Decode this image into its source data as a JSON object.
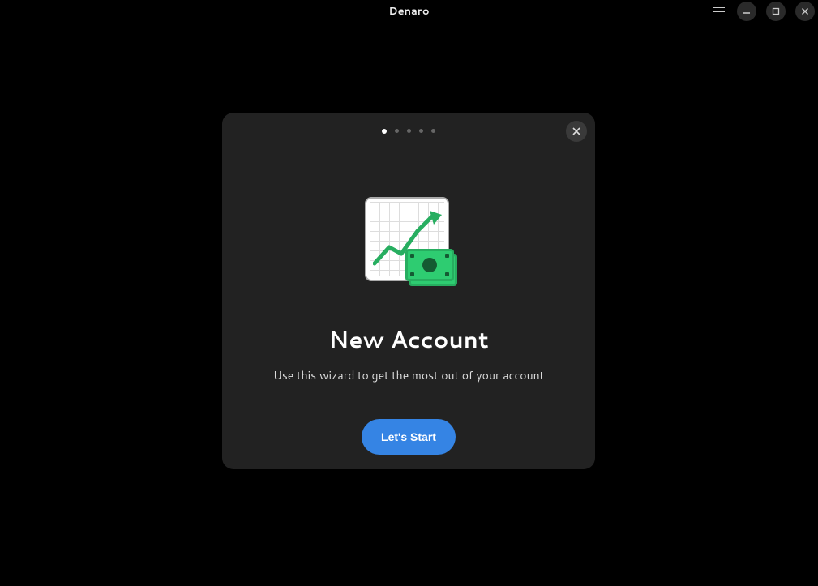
{
  "titlebar": {
    "title": "Denaro"
  },
  "modal": {
    "title": "New Account",
    "subtitle": "Use this wizard to get the most out of your account",
    "start_button": "Let's Start",
    "page_count": 5,
    "active_page": 1
  }
}
